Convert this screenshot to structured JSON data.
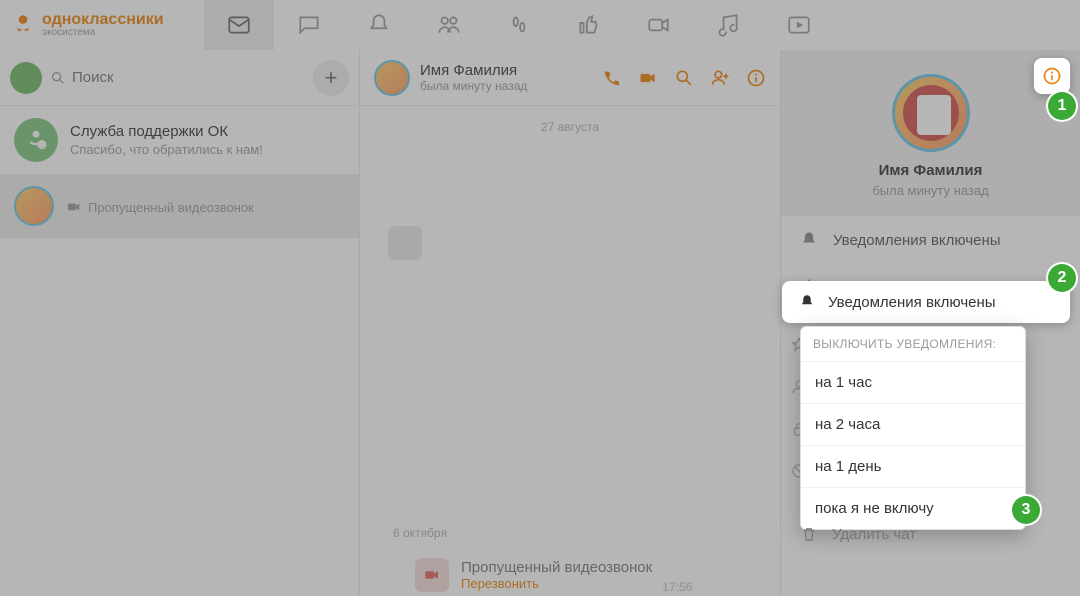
{
  "brand": {
    "name": "одноклассники",
    "sub": "экосистема"
  },
  "search": {
    "placeholder": "Поиск"
  },
  "chats": [
    {
      "title": "Служба поддержки ОК",
      "subtitle": "Спасибо, что обратились к нам!"
    },
    {
      "title": "",
      "subtitle": "Пропущенный видеозвонок"
    }
  ],
  "header": {
    "title": "Имя Фамилия",
    "subtitle": "была минуту назад"
  },
  "dates": {
    "d1": "27 августа",
    "d2": "6 октября"
  },
  "missed": {
    "title": "Пропущенный видеозвонок",
    "action": "Перезвонить",
    "time": "17:56"
  },
  "profile": {
    "name": "Имя Фамилия",
    "status": "была минуту назад"
  },
  "actions": {
    "notifications_on": "Уведомления включены",
    "delete_chat": "Удалить чат"
  },
  "dropdown": {
    "heading": "ВЫКЛЮЧИТЬ УВЕДОМЛЕНИЯ:",
    "items": [
      "на 1 час",
      "на 2 часа",
      "на 1 день",
      "пока я не включу"
    ]
  },
  "callouts": {
    "c1": "1",
    "c2": "2",
    "c3": "3"
  }
}
